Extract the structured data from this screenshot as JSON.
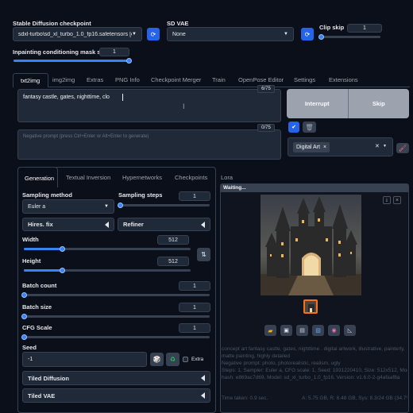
{
  "header": {
    "checkpoint_label": "Stable Diffusion checkpoint",
    "checkpoint_value": "sdxl-turbo\\sd_xl_turbo_1.0_fp16.safetensors [e",
    "vae_label": "SD VAE",
    "vae_value": "None",
    "clip_skip_label": "Clip skip",
    "clip_skip_value": "1",
    "clip_skip_level": 0.0,
    "mask_strength_label": "Inpainting conditioning mask strength",
    "mask_strength_value": "1",
    "mask_strength_level": 1.0
  },
  "tabs": [
    "txt2img",
    "img2img",
    "Extras",
    "PNG Info",
    "Checkpoint Merger",
    "Train",
    "OpenPose Editor",
    "Settings",
    "Extensions"
  ],
  "prompt": {
    "text": "fantasy castle, gates, nighttime, clo",
    "token_count": "6/75",
    "negative_placeholder": "Negative prompt (press Ctrl+Enter or Alt+Enter to generate)",
    "negative_token_count": "0/75"
  },
  "actions": {
    "interrupt_label": "Interrupt",
    "skip_label": "Skip",
    "style_tag": "Digital Art",
    "style_tag_remove": "×",
    "style_clear": "✕"
  },
  "subtabs": [
    "Generation",
    "Textual Inversion",
    "Hypernetworks",
    "Checkpoints",
    "Lora"
  ],
  "settings": {
    "sampling_method_label": "Sampling method",
    "sampling_method_value": "Euler a",
    "sampling_steps_label": "Sampling steps",
    "sampling_steps_value": "1",
    "sampling_steps_level": 0.0,
    "hires_label": "Hires. fix",
    "refiner_label": "Refiner",
    "width_label": "Width",
    "width_value": "512",
    "width_level": 0.23,
    "height_label": "Height",
    "height_value": "512",
    "height_level": 0.23,
    "batch_count_label": "Batch count",
    "batch_count_value": "1",
    "batch_count_level": 0.0,
    "batch_size_label": "Batch size",
    "batch_size_value": "1",
    "batch_size_level": 0.0,
    "cfg_label": "CFG Scale",
    "cfg_value": "1",
    "cfg_level": 0.0,
    "seed_label": "Seed",
    "seed_value": "-1",
    "extra_label": "Extra",
    "tiled_diffusion_label": "Tiled Diffusion",
    "tiled_vae_label": "Tiled VAE"
  },
  "output": {
    "status": "Waiting...",
    "info_prompt": "concept art fantasy castle, gates, nighttime . digital artwork, illustrative, painterly, matte painting, highly detailed",
    "info_negative": "Negative prompt: photo, photorealistic, realism, ugly",
    "info_steps": "Steps: 1, Sampler: Euler a, CFG scale: 1, Seed: 1931220410, Size: 512x512, Model",
    "info_model": "hash: e869ac7d69, Model: sd_xl_turbo_1.0_fp16, Version: v1.6.0-2-g4afaaf8a",
    "time_taken": "Time taken: 0.9 sec.",
    "vram": "A: 5.75 GB, R: 6.48 GB, Sys: 8.3/24 GB (34.7%)"
  },
  "colors": {
    "accent": "#3b82f6",
    "background": "#0b0f19",
    "panel": "#1f2937"
  }
}
